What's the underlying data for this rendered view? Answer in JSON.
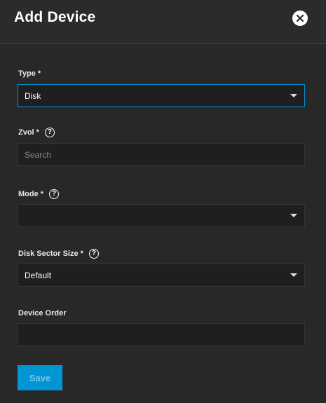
{
  "dialog": {
    "title": "Add Device"
  },
  "fields": {
    "type": {
      "label": "Type",
      "required_mark": "*",
      "value": "Disk"
    },
    "zvol": {
      "label": "Zvol",
      "required_mark": "*",
      "placeholder": "Search",
      "value": ""
    },
    "mode": {
      "label": "Mode",
      "required_mark": "*",
      "value": ""
    },
    "disk_sector_size": {
      "label": "Disk Sector Size",
      "required_mark": "*",
      "value": "Default"
    },
    "device_order": {
      "label": "Device Order",
      "value": ""
    }
  },
  "help_glyph": "?",
  "actions": {
    "save_label": "Save"
  },
  "colors": {
    "background": "#282828",
    "field_background": "#1f1f1f",
    "accent": "#0095d5"
  },
  "icons": {
    "close": "close-icon",
    "help": "help-icon",
    "dropdown": "chevron-down-icon"
  }
}
